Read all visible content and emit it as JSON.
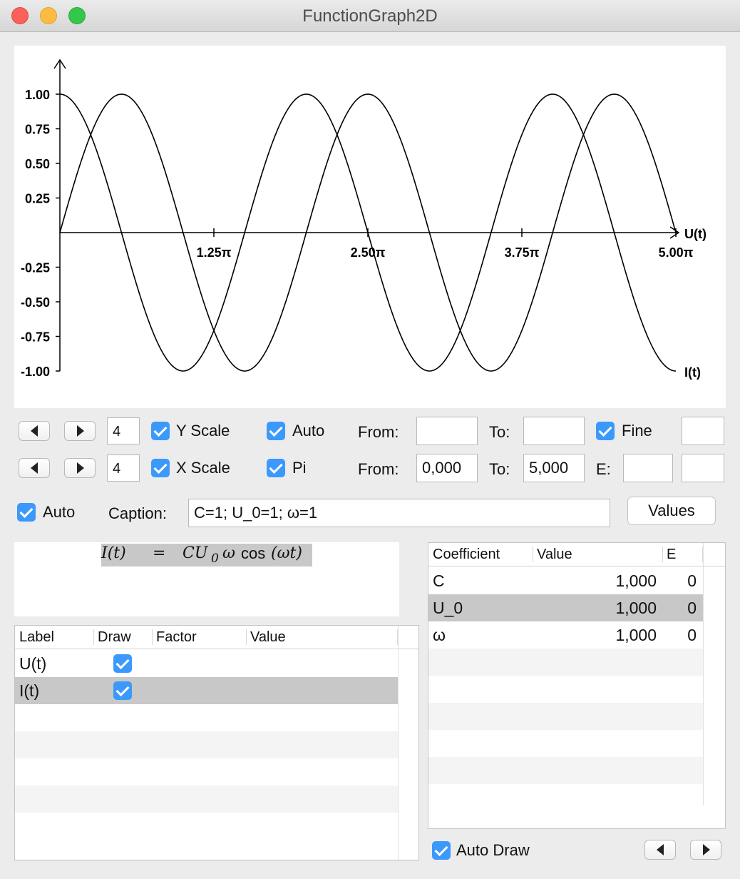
{
  "window": {
    "title": "FunctionGraph2D"
  },
  "graph": {
    "y_ticks": [
      "1.00",
      "0.75",
      "0.50",
      "0.25",
      "-0.25",
      "-0.50",
      "-0.75",
      "-1.00"
    ],
    "y_tick_values": [
      1.0,
      0.75,
      0.5,
      0.25,
      -0.25,
      -0.5,
      -0.75,
      -1.0
    ],
    "x_ticks": [
      "1.25π",
      "2.50π",
      "3.75π",
      "5.00π"
    ],
    "x_tick_values": [
      1.25,
      2.5,
      3.75,
      5.0
    ],
    "x_range": [
      0,
      5
    ],
    "y_range": [
      -1,
      1
    ],
    "curve_labels": [
      "U(t)",
      "I(t)"
    ],
    "axis_color": "#000000",
    "curve_color": "#000000"
  },
  "controls": {
    "y_row": {
      "step_value": "4",
      "scale_label": "Y Scale",
      "auto_label": "Auto",
      "from_label": "From:",
      "from_value": "",
      "to_label": "To:",
      "to_value": "",
      "fine_label": "Fine",
      "extra_value": ""
    },
    "x_row": {
      "step_value": "4",
      "scale_label": "X Scale",
      "pi_label": "Pi",
      "from_label": "From:",
      "from_value": "0,000",
      "to_label": "To:",
      "to_value": "5,000",
      "e_label": "E:",
      "e_value": "",
      "extra_value": ""
    },
    "auto_label": "Auto",
    "caption_label": "Caption:",
    "caption_value": "C=1; U_0=1; ω=1",
    "values_button": "Values"
  },
  "formula": {
    "lhs": "I(t)",
    "eq": "=",
    "rhs_a": "CU",
    "rhs_sub": "0",
    "rhs_b": "ω",
    "rhs_cos": "cos",
    "rhs_arg": "(ωt)"
  },
  "functions_table": {
    "columns": [
      "Label",
      "Draw",
      "Factor",
      "Value"
    ],
    "rows": [
      {
        "label": "U(t)",
        "draw": true,
        "factor": "",
        "value": ""
      },
      {
        "label": "I(t)",
        "draw": true,
        "factor": "",
        "value": ""
      }
    ]
  },
  "coefficients_table": {
    "columns": [
      "Coefficient",
      "Value",
      "E"
    ],
    "rows": [
      {
        "name": "C",
        "value": "1,000",
        "e": "0"
      },
      {
        "name": "U_0",
        "value": "1,000",
        "e": "0"
      },
      {
        "name": "ω",
        "value": "1,000",
        "e": "0"
      }
    ]
  },
  "bottom": {
    "auto_draw_label": "Auto Draw"
  },
  "colors": {
    "checkbox": "#3b99fc",
    "selection": "#c8c8c8"
  }
}
